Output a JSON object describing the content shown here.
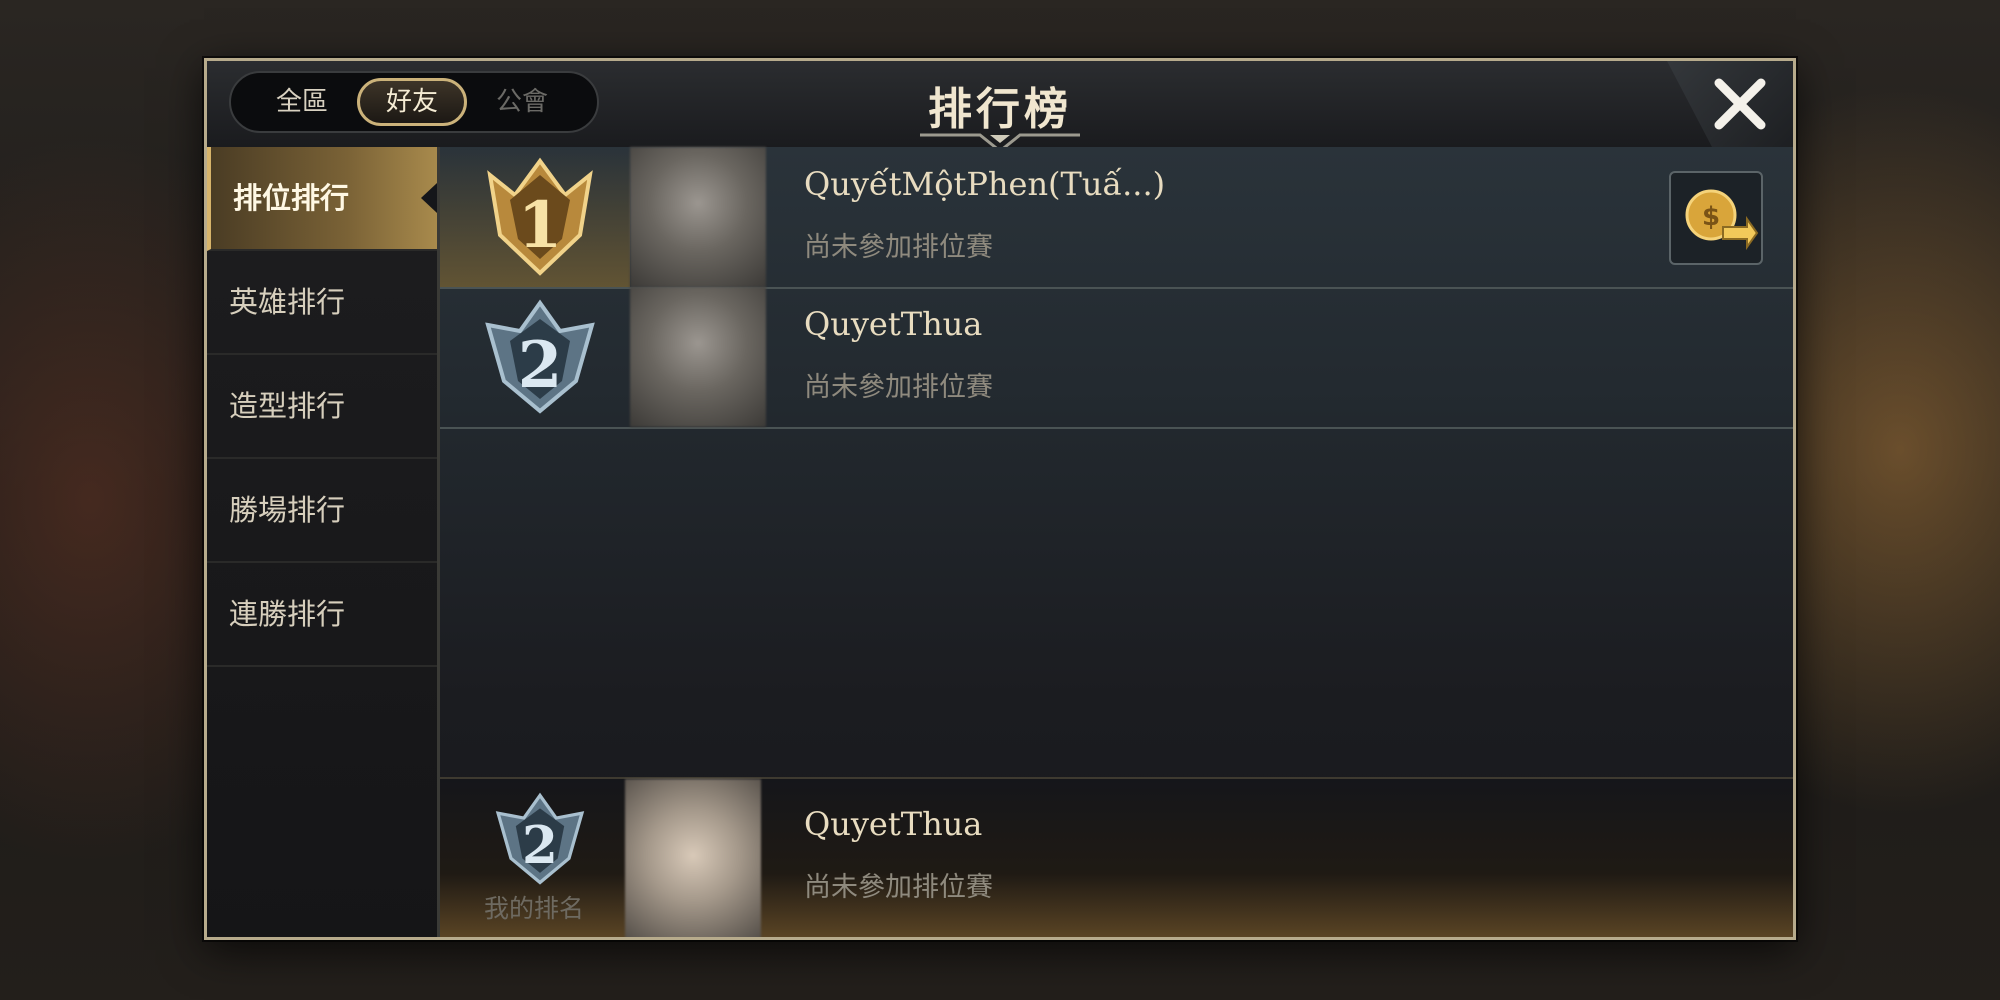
{
  "header": {
    "title": "排行榜",
    "tabs": [
      {
        "label": "全區",
        "state": "normal"
      },
      {
        "label": "好友",
        "state": "active"
      },
      {
        "label": "公會",
        "state": "disabled"
      }
    ],
    "close_icon": "close-icon"
  },
  "sidebar": {
    "items": [
      {
        "label": "排位排行",
        "active": true
      },
      {
        "label": "英雄排行",
        "active": false
      },
      {
        "label": "造型排行",
        "active": false
      },
      {
        "label": "勝場排行",
        "active": false
      },
      {
        "label": "連勝排行",
        "active": false
      }
    ]
  },
  "list": {
    "rows": [
      {
        "rank": "1",
        "name": "QuyếtMộtPhen(Tuấ...)",
        "status": "尚未參加排位賽"
      },
      {
        "rank": "2",
        "name": "QuyetThua",
        "status": "尚未參加排位賽"
      }
    ],
    "share_icon": "gold-coin-share-icon"
  },
  "my_rank": {
    "rank": "2",
    "label": "我的排名",
    "name": "QuyetThua",
    "status": "尚未參加排位賽"
  },
  "colors": {
    "accent_gold": "#cbb27a",
    "title_text": "#f0e6cf",
    "status_text": "#8f8a7e"
  }
}
